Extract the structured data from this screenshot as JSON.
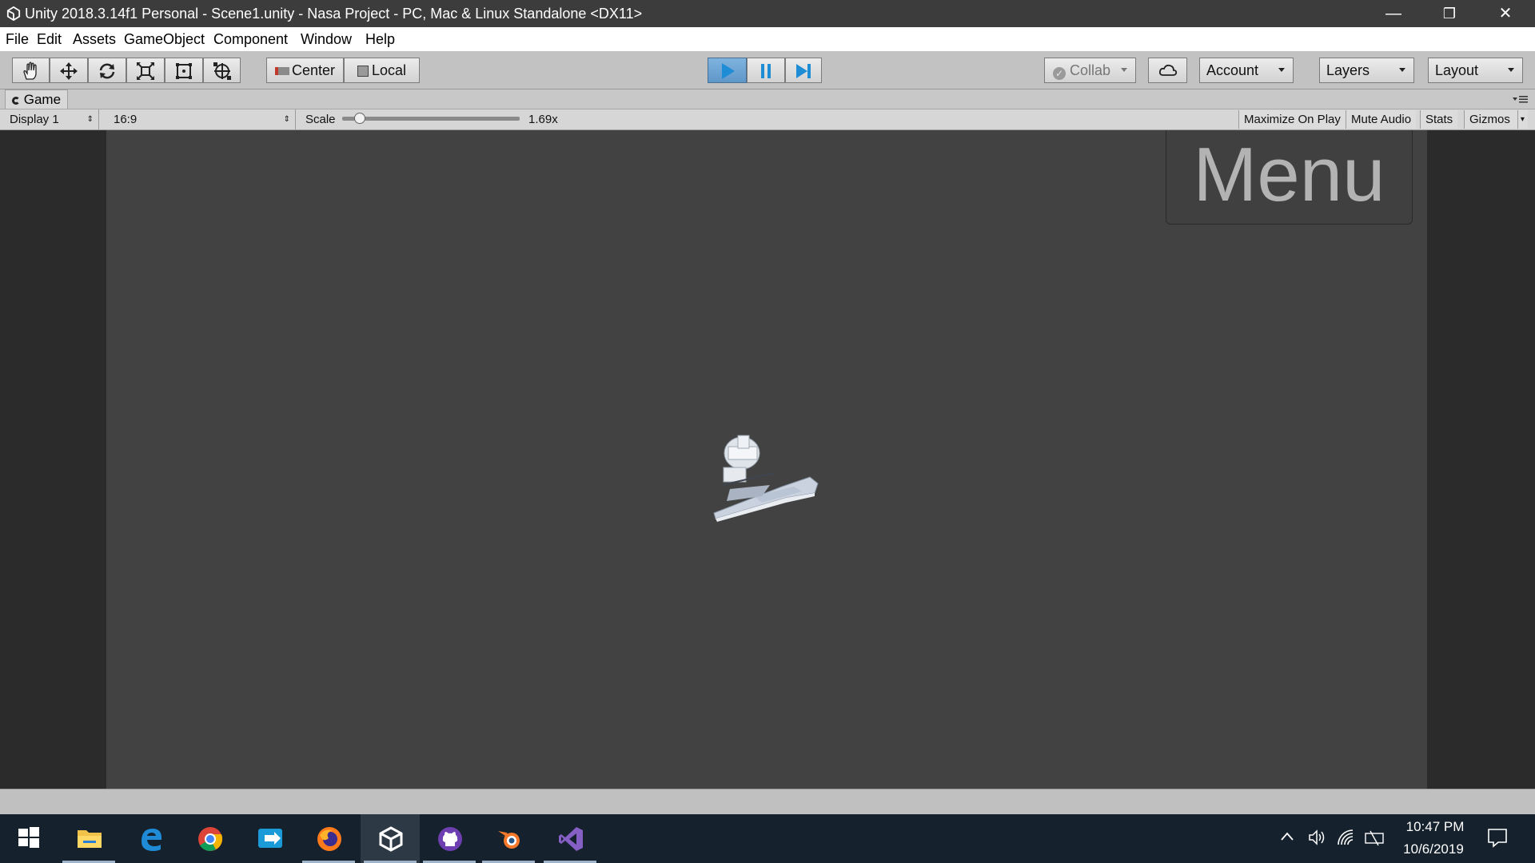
{
  "titlebar": {
    "title": "Unity 2018.3.14f1 Personal - Scene1.unity - Nasa Project - PC, Mac & Linux Standalone <DX11>",
    "logo_icon": "unity-icon",
    "minimize": "—",
    "restore": "❐",
    "close": "✕"
  },
  "menubar": {
    "items": [
      "File",
      "Edit",
      "Assets",
      "GameObject",
      "Component",
      "Window",
      "Help"
    ]
  },
  "toolbar": {
    "tools": [
      "hand-icon",
      "move-icon",
      "rotate-icon",
      "scale-icon",
      "rect-icon",
      "transform-icon"
    ],
    "pivot_center": "Center",
    "pivot_local": "Local",
    "play_state": "playing",
    "collab": "Collab",
    "account": "Account",
    "layers": "Layers",
    "layout": "Layout",
    "accent": "#1f8dd6"
  },
  "game_panel": {
    "tab_label": "Game",
    "display": "Display 1",
    "aspect": "16:9",
    "scale_label": "Scale",
    "scale_value": "1.69x",
    "scale_fraction": 0.1,
    "maximize_on_play": "Maximize On Play",
    "mute_audio": "Mute Audio",
    "stats": "Stats",
    "gizmos": "Gizmos",
    "menu_text": "Menu"
  },
  "taskbar": {
    "apps": [
      "windows-start-icon",
      "file-explorer-icon",
      "edge-icon",
      "chrome-icon",
      "remote-desktop-icon",
      "firefox-icon",
      "unity-icon",
      "github-icon",
      "blender-icon",
      "visual-studio-icon"
    ],
    "time": "10:47 PM",
    "date": "10/6/2019"
  }
}
